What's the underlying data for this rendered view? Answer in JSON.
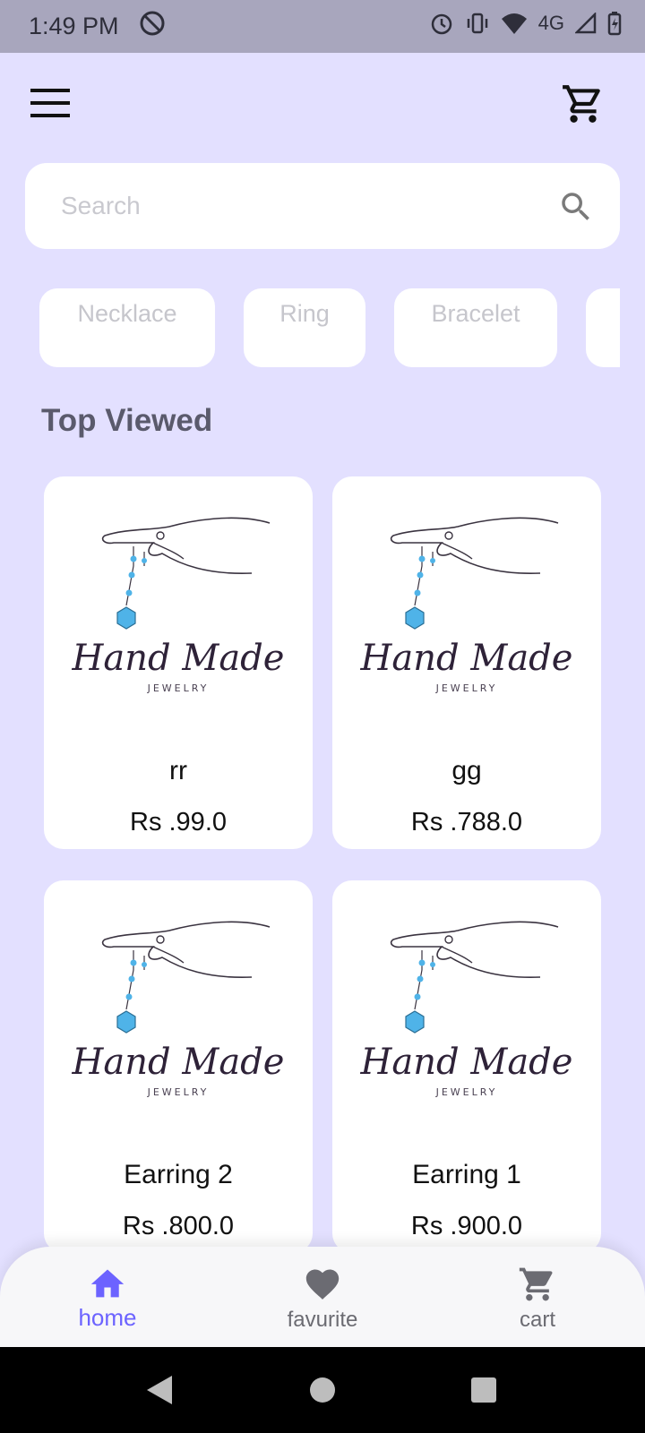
{
  "status_bar": {
    "time": "1:49 PM",
    "network": "4G"
  },
  "header": {
    "menu_icon": "hamburger-menu-icon",
    "cart_icon": "shopping-cart-icon"
  },
  "search": {
    "placeholder": "Search",
    "value": ""
  },
  "categories": [
    {
      "label": "Necklace"
    },
    {
      "label": "Ring"
    },
    {
      "label": "Bracelet"
    },
    {
      "label": ""
    }
  ],
  "section": {
    "title": "Top Viewed"
  },
  "products": [
    {
      "name": "rr",
      "price": "Rs .99.0"
    },
    {
      "name": "gg",
      "price": "Rs .788.0"
    },
    {
      "name": "Earring 2",
      "price": "Rs .800.0"
    },
    {
      "name": "Earring 1",
      "price": "Rs .900.0"
    }
  ],
  "logo": {
    "script": "Hand Made",
    "subtitle": "JEWELRY"
  },
  "bottom_nav": [
    {
      "label": "home",
      "icon": "home-icon",
      "active": true
    },
    {
      "label": "favurite",
      "icon": "heart-icon",
      "active": false
    },
    {
      "label": "cart",
      "icon": "cart-icon",
      "active": false
    }
  ],
  "colors": {
    "background": "#e3e0ff",
    "accent": "#6c63ff",
    "gem": "#4fb3e8"
  }
}
